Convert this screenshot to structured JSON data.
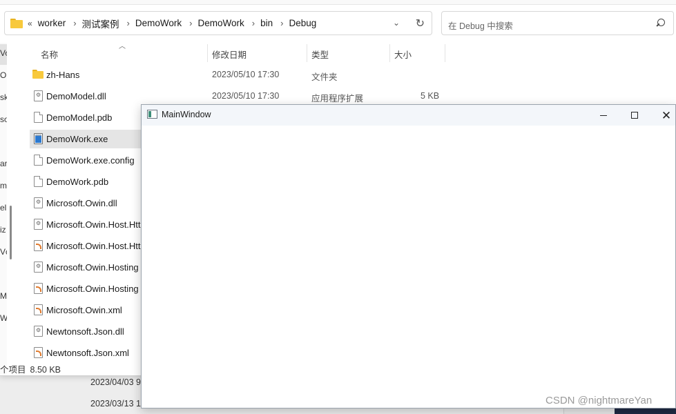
{
  "address_bar": {
    "more": "«",
    "crumbs": [
      "worker",
      "测试案例",
      "DemoWork",
      "DemoWork",
      "bin",
      "Debug"
    ],
    "separator": "›",
    "dropdown": "⌄",
    "refresh": "↻"
  },
  "search": {
    "placeholder": "在 Debug 中搜索"
  },
  "nav": {
    "fragments": [
      "Vo",
      "OI",
      "sk",
      "so",
      "ar",
      "m",
      "el",
      "iz",
      "Vc",
      "M",
      "W"
    ]
  },
  "columns": {
    "name": "名称",
    "date": "修改日期",
    "type": "类型",
    "size": "大小"
  },
  "files": [
    {
      "name": "zh-Hans",
      "date": "2023/05/10 17:30",
      "type": "文件夹",
      "size": "",
      "icon": "folder-icon"
    },
    {
      "name": "DemoModel.dll",
      "date": "2023/05/10 17:30",
      "type": "应用程序扩展",
      "size": "5 KB",
      "icon": "dll-file-icon"
    },
    {
      "name": "DemoModel.pdb",
      "date": "",
      "type": "",
      "size": "",
      "icon": "file-icon"
    },
    {
      "name": "DemoWork.exe",
      "date": "",
      "type": "",
      "size": "",
      "icon": "exe-file-icon"
    },
    {
      "name": "DemoWork.exe.config",
      "date": "",
      "type": "",
      "size": "",
      "icon": "file-icon"
    },
    {
      "name": "DemoWork.pdb",
      "date": "",
      "type": "",
      "size": "",
      "icon": "file-icon"
    },
    {
      "name": "Microsoft.Owin.dll",
      "date": "",
      "type": "",
      "size": "",
      "icon": "dll-file-icon"
    },
    {
      "name": "Microsoft.Owin.Host.Htt",
      "date": "",
      "type": "",
      "size": "",
      "icon": "dll-file-icon"
    },
    {
      "name": "Microsoft.Owin.Host.Htt",
      "date": "",
      "type": "",
      "size": "",
      "icon": "xml-file-icon"
    },
    {
      "name": "Microsoft.Owin.Hosting",
      "date": "",
      "type": "",
      "size": "",
      "icon": "dll-file-icon"
    },
    {
      "name": "Microsoft.Owin.Hosting",
      "date": "",
      "type": "",
      "size": "",
      "icon": "xml-file-icon"
    },
    {
      "name": "Microsoft.Owin.xml",
      "date": "",
      "type": "",
      "size": "",
      "icon": "xml-file-icon"
    },
    {
      "name": "Newtonsoft.Json.dll",
      "date": "",
      "type": "",
      "size": "",
      "icon": "dll-file-icon"
    },
    {
      "name": "Newtonsoft.Json.xml",
      "date": "",
      "type": "",
      "size": "",
      "icon": "xml-file-icon"
    }
  ],
  "selected_file": "DemoWork.exe",
  "status": {
    "count": "个项目",
    "size": "8.50 KB"
  },
  "background_dates": [
    "2023/04/03 9",
    "2023/03/13 1"
  ],
  "main_window": {
    "title": "MainWindow",
    "minimize": "—",
    "maximize": "☐",
    "close": "✕"
  },
  "watermark": "CSDN @nightmareYan"
}
